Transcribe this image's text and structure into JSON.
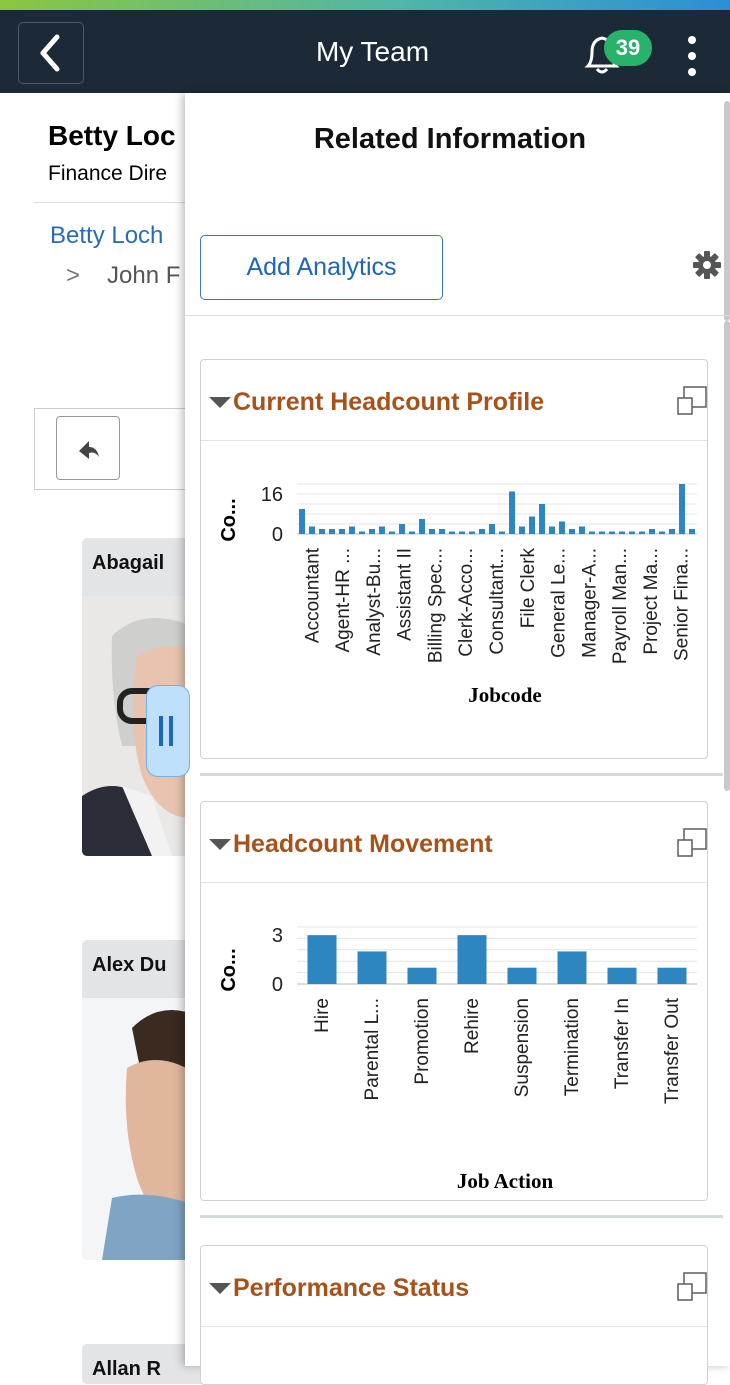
{
  "header": {
    "title": "My Team",
    "notification_count": "39"
  },
  "background": {
    "employee_name": "Betty Loc",
    "employee_role": "Finance Dire",
    "breadcrumb_link": "Betty Loch",
    "breadcrumb_chevron": ">",
    "breadcrumb_child": "John F",
    "cards": [
      {
        "name": "Abagail"
      },
      {
        "name": "Alex Du"
      },
      {
        "name": "Allan R"
      }
    ]
  },
  "panel": {
    "title": "Related Information",
    "add_analytics_label": "Add Analytics",
    "pagelets": [
      {
        "title": "Current Headcount Profile"
      },
      {
        "title": "Headcount Movement"
      },
      {
        "title": "Performance Status"
      }
    ]
  },
  "colors": {
    "header_bg": "#1b2a36",
    "bar": "#2e86c1",
    "pagelet_title": "#a8521b",
    "badge": "#27b36a"
  },
  "icons": {
    "back": "chevron-left-icon",
    "bell": "bell-icon",
    "menu": "kebab-menu-icon",
    "gear": "gear-icon",
    "maximize": "maximize-icon",
    "collapse": "triangle-down-icon"
  },
  "chart_data": [
    {
      "type": "bar",
      "ylabel": "Co...",
      "xlabel": "Jobcode",
      "yticks": [
        0,
        16
      ],
      "ylim": [
        0,
        20
      ],
      "values": [
        10,
        3,
        2,
        2,
        2,
        3,
        1,
        2,
        3,
        1,
        4,
        1,
        6,
        2,
        2,
        1,
        1,
        1,
        2,
        4,
        1,
        17,
        3,
        7,
        12,
        3,
        5,
        2,
        3,
        1,
        1,
        1,
        1,
        1,
        1,
        2,
        1,
        2,
        20,
        2
      ],
      "categories": [
        "Accountant",
        "Agent-HR ...",
        "Analyst-Bu...",
        "Assistant II",
        "Billing Spec...",
        "Clerk-Acco...",
        "Consultant...",
        "File Clerk",
        "General Le...",
        "Manager-A...",
        "Payroll Man...",
        "Project Ma...",
        "Senior Fina..."
      ]
    },
    {
      "type": "bar",
      "ylabel": "Co...",
      "xlabel": "Job Action",
      "yticks": [
        0,
        3
      ],
      "ylim": [
        0,
        3.5
      ],
      "categories": [
        "Hire",
        "Parental L...",
        "Promotion",
        "Rehire",
        "Suspension",
        "Termination",
        "Transfer In",
        "Transfer Out"
      ],
      "values": [
        3,
        2,
        1,
        3,
        1,
        2,
        1,
        1
      ]
    }
  ]
}
